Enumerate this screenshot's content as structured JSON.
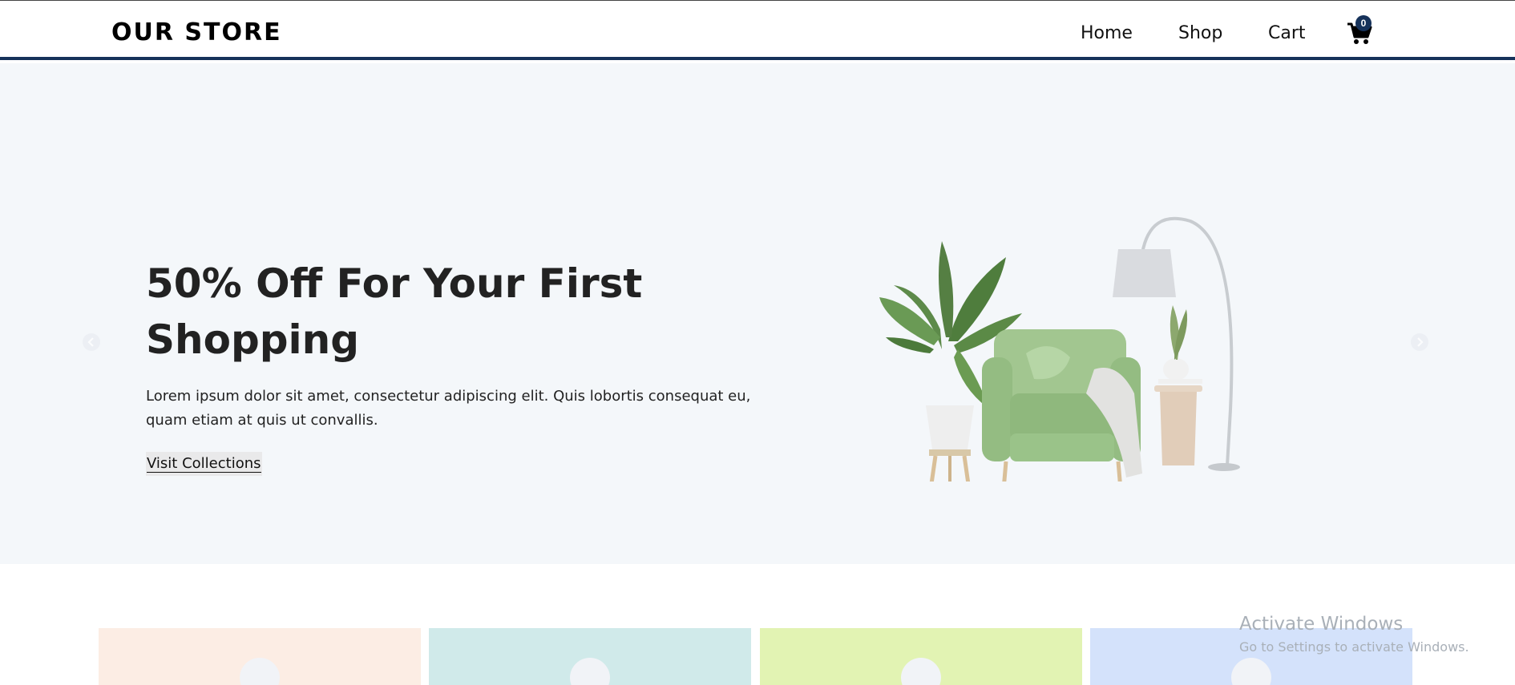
{
  "header": {
    "brand": "OUR STORE",
    "nav": [
      {
        "label": "Home"
      },
      {
        "label": "Shop"
      },
      {
        "label": "Cart"
      }
    ],
    "cart_icon": "shopping-cart-icon",
    "cart_count": "0",
    "accent_color": "#16325a"
  },
  "hero": {
    "title": "50% Off For Your First Shopping",
    "description": "Lorem ipsum dolor sit amet, consectetur adipiscing elit. Quis lobortis consequat eu, quam etiam at quis ut convallis.",
    "button_label": "Visit Collections",
    "prev_icon": "chevron-left-icon",
    "next_icon": "chevron-right-icon",
    "background_color": "#f4f7fa"
  },
  "categories": [
    {
      "color": "#fcede4"
    },
    {
      "color": "#d0eaea"
    },
    {
      "color": "#e2f3b3"
    },
    {
      "color": "#d4e2fb"
    }
  ],
  "watermark": {
    "title": "Activate Windows",
    "subtitle": "Go to Settings to activate Windows."
  }
}
